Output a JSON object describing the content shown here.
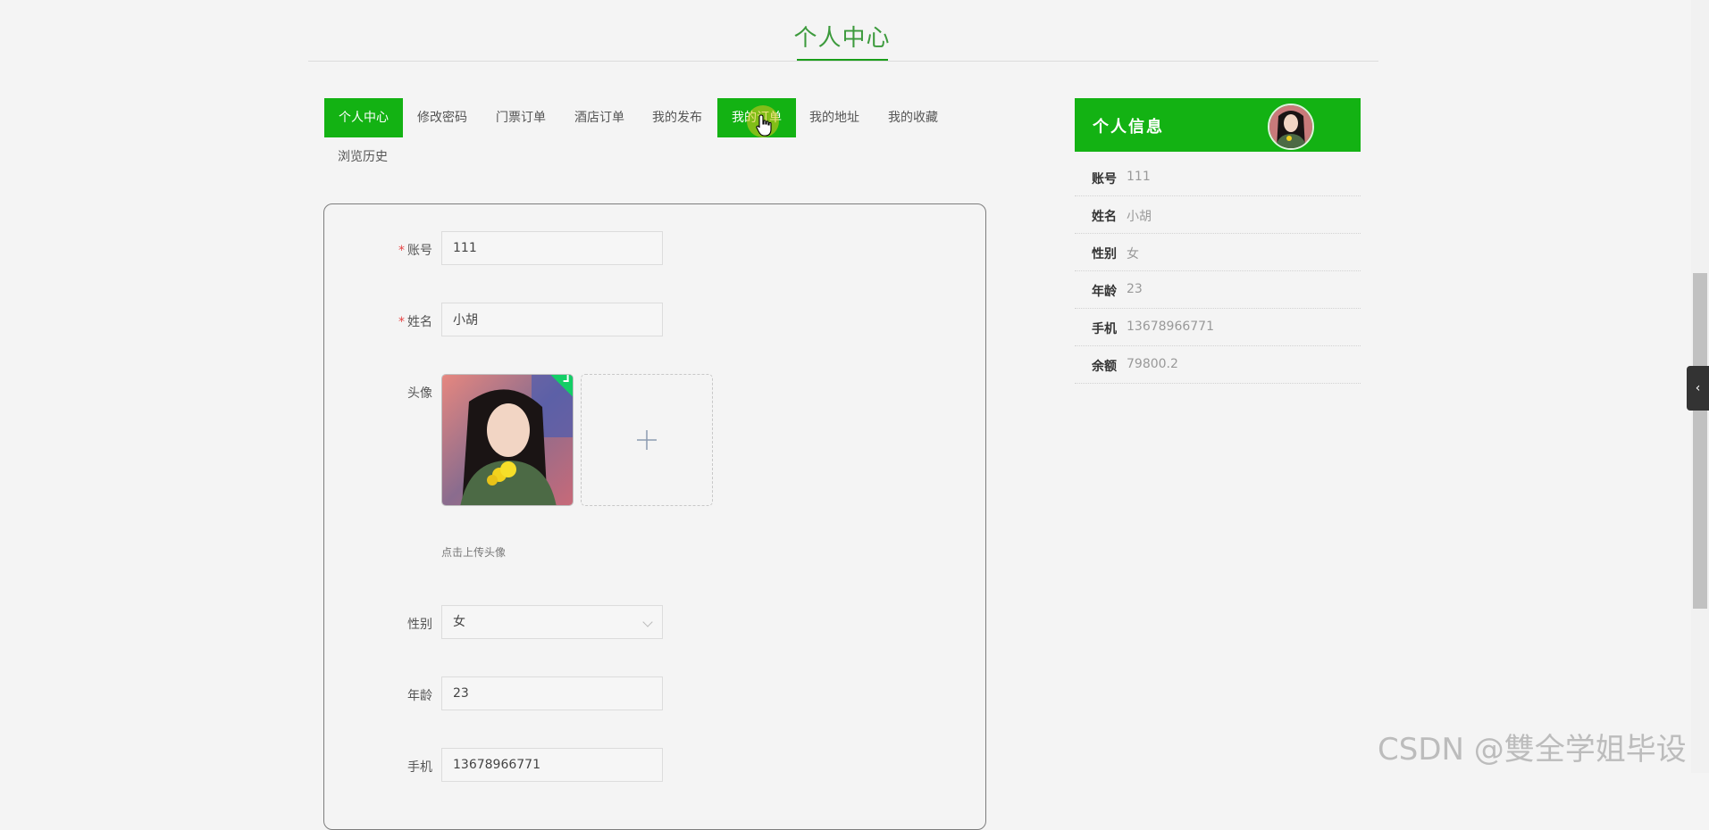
{
  "page_title": "个人中心",
  "tabs": [
    {
      "label": "个人中心",
      "state": "active"
    },
    {
      "label": "修改密码",
      "state": "normal"
    },
    {
      "label": "门票订单",
      "state": "normal"
    },
    {
      "label": "酒店订单",
      "state": "normal"
    },
    {
      "label": "我的发布",
      "state": "normal"
    },
    {
      "label": "我的订单",
      "state": "hover"
    },
    {
      "label": "我的地址",
      "state": "normal"
    },
    {
      "label": "我的收藏",
      "state": "normal"
    },
    {
      "label": "浏览历史",
      "state": "normal"
    }
  ],
  "form": {
    "account": {
      "label": "账号",
      "value": "111",
      "required": true
    },
    "name": {
      "label": "姓名",
      "value": "小胡",
      "required": true
    },
    "avatar": {
      "label": "头像",
      "upload_tip": "点击上传头像",
      "upload_icon": "plus-icon"
    },
    "gender": {
      "label": "性别",
      "value": "女"
    },
    "age": {
      "label": "年龄",
      "value": "23"
    },
    "phone": {
      "label": "手机",
      "value": "13678966771"
    }
  },
  "info_panel": {
    "title": "个人信息",
    "rows": [
      {
        "key": "账号",
        "value": "111"
      },
      {
        "key": "姓名",
        "value": "小胡"
      },
      {
        "key": "性别",
        "value": "女"
      },
      {
        "key": "年龄",
        "value": "23"
      },
      {
        "key": "手机",
        "value": "13678966771"
      },
      {
        "key": "余额",
        "value": "79800.2"
      }
    ]
  },
  "side_handle_icon": "chevron-left-icon",
  "watermark": "CSDN @雙全学姐毕设",
  "colors": {
    "accent": "#13b213",
    "title": "#3c9a3c",
    "required": "#e64545"
  }
}
